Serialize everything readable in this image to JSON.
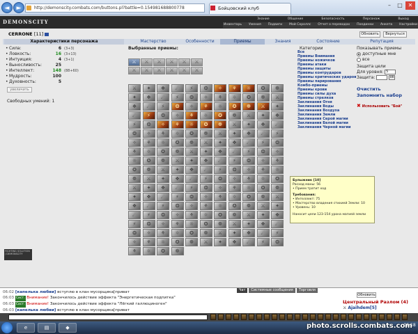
{
  "browser": {
    "url": "http://demonscity.combats.com/buttons.pl?battle=0.154981688800778",
    "tab_title": "Бойцовский клуб",
    "nav_back": "◄",
    "nav_forward": "►",
    "win_min": "–",
    "win_max": "□",
    "win_close": "✕"
  },
  "game": {
    "logo": "DEMONSCITY",
    "top_menu": [
      "Знание",
      "Общение",
      "Безопасность",
      "Персонаж",
      "Выход"
    ],
    "top_menu2": [
      "Инвентарь",
      "Умения",
      "Подвиги",
      "Мой Скроллс",
      "Отчет о переводах",
      "Поединки",
      "Анкета",
      "Настройки"
    ]
  },
  "character": {
    "name": "CERRONE",
    "level": "[11]"
  },
  "buttons": {
    "refresh": "Обновить",
    "back": "Вернуться",
    "enlarge": "увеличить"
  },
  "tabs": {
    "stats": "Характеристики персонажа",
    "mastery": "Мастерство",
    "features": "Особенности",
    "skills": "Приемы",
    "knowledge": "Знания",
    "state": "Состояние",
    "reputation": "Репутация"
  },
  "stats": [
    {
      "name": "Сила:",
      "value": "6",
      "bonus": "(3+3)",
      "green": false
    },
    {
      "name": "Ловкость:",
      "value": "16",
      "bonus": "(3+13)",
      "green": true
    },
    {
      "name": "Интуиция:",
      "value": "4",
      "bonus": "(3+1)",
      "green": false
    },
    {
      "name": "Выносливость:",
      "value": "25",
      "bonus": "",
      "green": false
    },
    {
      "name": "Интеллект:",
      "value": "148",
      "bonus": "(88+60)",
      "green": true
    },
    {
      "name": "Мудрость:",
      "value": "100",
      "bonus": "",
      "green": false
    },
    {
      "name": "Духовность:",
      "value": "5",
      "bonus": "",
      "green": false
    }
  ],
  "free_skills": "Свободных умений: 1",
  "chosen": {
    "title": "Выбранные приемы:"
  },
  "categories": {
    "title": "Категории",
    "items": [
      "Все",
      "Приемы Внимания",
      "Приемы ножичков",
      "Приемы атаки",
      "Приемы защиты",
      "Приемы контрударов",
      "Приемы критических ударов",
      "Приемы парирования",
      "Комбо-приемы",
      "Приемы крови",
      "Приемы силы духа",
      "Приемы стрелков",
      "Заклинания Огня",
      "Заклинания Воды",
      "Заклинания Воздуха",
      "Заклинания Земли",
      "Заклинания Серой магии",
      "Заклинания Белой магии",
      "Заклинания Черной магии"
    ]
  },
  "right_panel": {
    "show_label": "Показывать приемы",
    "opt_available": "доступные мне",
    "opt_all": "все",
    "target_label": "Защита цели",
    "level_label": "Для уровня:",
    "level_value": "5",
    "protect_label": "Защита:",
    "ok": "ok",
    "clear": "Очистить",
    "remember": "Запомнить набор",
    "use_bot": "Использовать \"Бой\""
  },
  "tooltip": {
    "title": "Булыжник [10]",
    "lines": [
      "Расход маны: 56",
      "• Прием тратит ход",
      "",
      "Требования:",
      "• Интеллект: 75",
      "• Мастерство владения стихией Земли: 10",
      "• Уровень: 10",
      "",
      "Наносит цели 123-154 урона магией земли"
    ]
  },
  "bottom_logos": "FIGHTING SOLUTION / DEMONSCITY",
  "chat": {
    "tabs": [
      "Чат",
      "Системные сообщения",
      "Торговля"
    ],
    "lines": [
      {
        "time": "06:02",
        "tag": "",
        "warn": "",
        "nick": "[капелька любви]",
        "text": " вступлю в клан мусорщика[приват"
      },
      {
        "time": "06:03",
        "tag": "Сист.",
        "warn": "Внимание!",
        "nick": "",
        "text": " Закончилось действие эффекта \"Энергетическая подпитка\""
      },
      {
        "time": "06:03",
        "tag": "Сист.",
        "warn": "Внимание!",
        "nick": "",
        "text": " Закончилось действие эффекта \"Лёгкий галлюциноген\""
      },
      {
        "time": "06:03",
        "tag": "",
        "warn": "",
        "nick": "[капелька любви]",
        "text": " вступлю в клан мусорщика[приват"
      }
    ],
    "refresh": "Обновить",
    "location": "Центральный Разлом (4)",
    "player": "Ajaihdem[5]"
  },
  "taskbar": {
    "time": "06:18"
  },
  "watermark": "photo.scrolls.combats.com"
}
